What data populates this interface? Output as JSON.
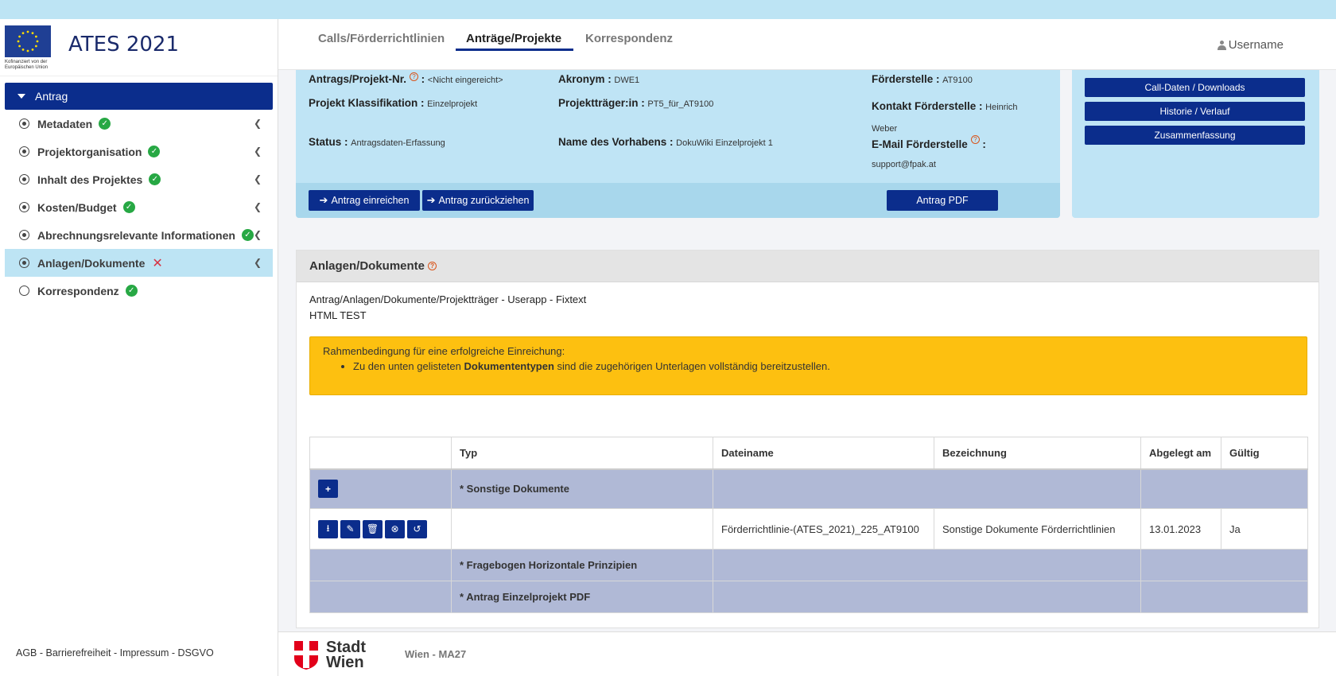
{
  "app": {
    "title": "ATES 2021",
    "eu_caption": "Kofinanziert von der Europäischen Union"
  },
  "sidebar": {
    "head": "Antrag",
    "items": [
      {
        "label": "Metadaten",
        "status": "ok"
      },
      {
        "label": "Projektorganisation",
        "status": "ok"
      },
      {
        "label": "Inhalt des Projektes",
        "status": "ok"
      },
      {
        "label": "Kosten/Budget",
        "status": "ok"
      },
      {
        "label": "Abrechnungsrelevante Informationen",
        "status": "ok"
      },
      {
        "label": "Anlagen/Dokumente",
        "status": "error"
      },
      {
        "label": "Korrespondenz",
        "status": "ok"
      }
    ],
    "footer": "AGB - Barrierefreiheit - Impressum - DSGVO"
  },
  "topnav": {
    "tabs": [
      "Calls/Förderrichtlinien",
      "Anträge/Projekte",
      "Korrespondenz"
    ],
    "active_tab": "Anträge/Projekte",
    "user": "Username"
  },
  "info": {
    "antragsnr_label": "Antrags/Projekt-Nr.",
    "antragsnr_value": "<Nicht eingereicht>",
    "klassifikation_label": "Projekt Klassifikation :",
    "klassifikation_value": "Einzelprojekt",
    "status_label": "Status :",
    "status_value": "Antragsdaten-Erfassung",
    "akronym_label": "Akronym :",
    "akronym_value": "DWE1",
    "traeger_label": "Projektträger:in :",
    "traeger_value": "PT5_für_AT9100",
    "vorhaben_label": "Name des Vorhabens :",
    "vorhaben_value": "DokuWiki Einzelprojekt 1",
    "foerderstelle_label": "Förderstelle :",
    "foerderstelle_value": "AT9100",
    "kontakt_label": "Kontakt Förderstelle :",
    "kontakt_value_1": "Heinrich",
    "kontakt_value_2": "Weber",
    "email_label": "E-Mail Förderstelle",
    "email_value": "support@fpak.at",
    "btn_einreichen": "Antrag einreichen",
    "btn_zurueck": "Antrag zurückziehen",
    "btn_pdf": "Antrag PDF"
  },
  "side_buttons": [
    "Call-Daten / Downloads",
    "Historie / Verlauf",
    "Zusammenfassung"
  ],
  "documents": {
    "title": "Anlagen/Dokumente",
    "line1": "Antrag/Anlagen/Dokumente/Projektträger - Userapp - Fixtext",
    "line2": "HTML TEST",
    "notice_title": "Rahmenbedingung für eine erfolgreiche Einreichung:",
    "notice_pre": "Zu den unten gelisteten",
    "notice_bold": "Dokumententypen",
    "notice_post": "sind die zugehörigen Unterlagen vollständig bereitzustellen.",
    "columns": [
      "",
      "Typ",
      "Dateiname",
      "Bezeichnung",
      "Abgelegt am",
      "Gültig"
    ],
    "group1": "* Sonstige Dokumente",
    "row": {
      "dateiname": "Förderrichtlinie-(ATES_2021)_225_AT9100",
      "bezeichnung": "Sonstige Dokumente Förderrichtlinien",
      "abgelegt": "13.01.2023",
      "gueltig": "Ja"
    },
    "group2": "* Fragebogen Horizontale Prinzipien",
    "group3": "* Antrag Einzelprojekt PDF"
  },
  "bottom": {
    "logo_line1": "Stadt",
    "logo_line2": "Wien",
    "org": "Wien - MA27"
  }
}
